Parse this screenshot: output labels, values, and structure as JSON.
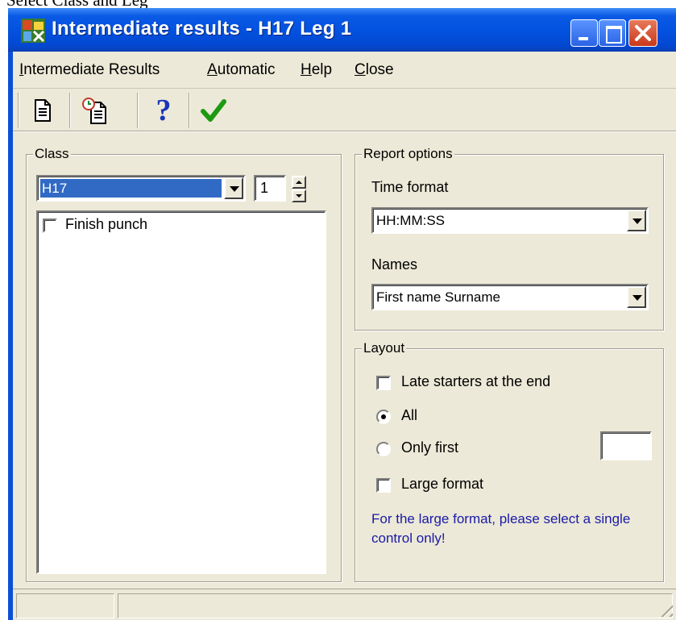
{
  "caption": "Select Class and Leg",
  "window": {
    "title": "Intermediate results - H17 Leg 1"
  },
  "menu": [
    "Intermediate Results",
    "Automatic",
    "Help",
    "Close"
  ],
  "toolbar": {
    "icons": [
      "new-report-icon",
      "timed-report-icon",
      "help-icon",
      "checkmark-icon"
    ],
    "help_glyph": "?"
  },
  "class_group": {
    "legend": "Class",
    "selected_class": "H17",
    "leg_value": "1",
    "controls": [
      {
        "label": "Finish punch",
        "checked": false
      }
    ]
  },
  "report_options": {
    "legend": "Report options",
    "time_format_label": "Time format",
    "time_format_value": "HH:MM:SS",
    "names_label": "Names",
    "names_value": "First name Surname"
  },
  "layout": {
    "legend": "Layout",
    "late_starters_label": "Late starters at the end",
    "late_starters_checked": false,
    "all_label": "All",
    "only_first_label": "Only first",
    "selected_radio": "All",
    "only_first_value": "",
    "large_format_label": "Large format",
    "large_format_checked": false,
    "note": "For the large format, please select a single control only!"
  },
  "colors": {
    "titlebar": "#0352e0",
    "dialog_bg": "#ece9d8",
    "selection": "#316ac5",
    "note_text": "#1a1aa8",
    "check_green": "#1d9a12"
  }
}
